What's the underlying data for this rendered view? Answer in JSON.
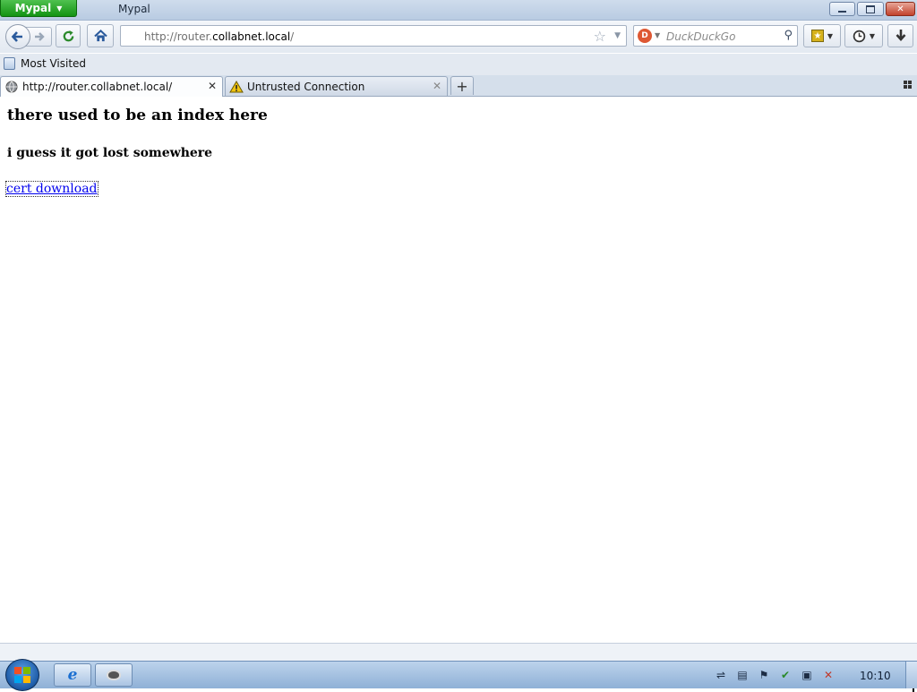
{
  "window": {
    "app_button_label": "Mypal",
    "title": "Mypal"
  },
  "navbar": {
    "url_prefix": "http://router.",
    "url_domain": "collabnet.local",
    "url_suffix": "/",
    "search_placeholder": "DuckDuckGo"
  },
  "bookmarks": {
    "items": [
      {
        "label": "Most Visited"
      }
    ]
  },
  "tabs": [
    {
      "label": "http://router.collabnet.local/",
      "active": true
    },
    {
      "label": "Untrusted Connection",
      "active": false
    }
  ],
  "page": {
    "heading": "there used to be an index here",
    "subheading": "i guess it got lost somewhere",
    "link_text": "cert download"
  },
  "taskbar": {
    "clock": "10:10"
  },
  "colors": {
    "link": "#0000ee",
    "app_button": "#139313",
    "close_button": "#c2422c"
  }
}
